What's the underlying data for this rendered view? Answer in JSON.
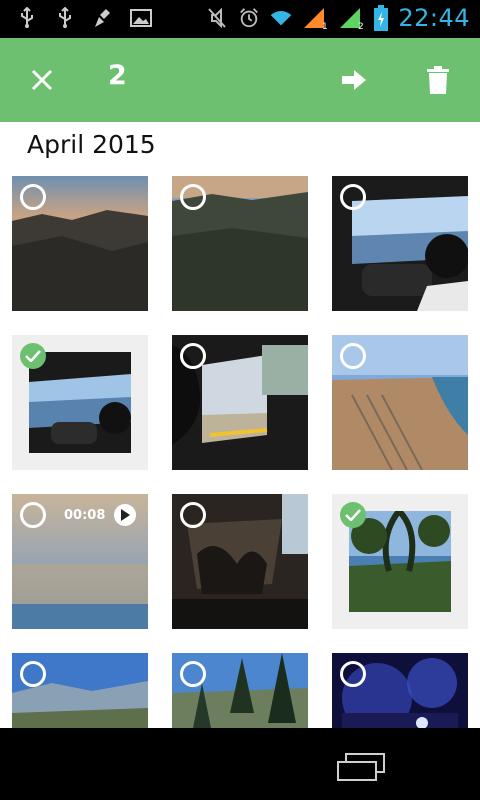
{
  "status_bar": {
    "time": "22:44",
    "icons": [
      "usb-icon",
      "usb-icon",
      "cleaner-icon",
      "image-icon",
      "mute-icon",
      "alarm-icon",
      "wifi-icon",
      "signal-icon",
      "signal-icon",
      "battery-icon"
    ],
    "network_labels": [
      "1",
      "2"
    ]
  },
  "action_bar": {
    "selected_count": "2",
    "close_icon": "close-icon",
    "share_icon": "forward-arrow-icon",
    "delete_icon": "trash-icon",
    "background_color": "#6cc070"
  },
  "gallery": {
    "section_title": "April 2015",
    "items": [
      {
        "kind": "photo",
        "selected": false,
        "scene": "mountain-sunset"
      },
      {
        "kind": "photo",
        "selected": false,
        "scene": "mountain-dusk"
      },
      {
        "kind": "photo",
        "selected": false,
        "scene": "helicopter-cockpit-sea"
      },
      {
        "kind": "photo",
        "selected": true,
        "scene": "helicopter-cockpit"
      },
      {
        "kind": "photo",
        "selected": false,
        "scene": "pilot-profile"
      },
      {
        "kind": "photo",
        "selected": false,
        "scene": "city-coast-aerial"
      },
      {
        "kind": "video",
        "selected": false,
        "duration": "00:08",
        "scene": "harbor-blur"
      },
      {
        "kind": "photo",
        "selected": false,
        "scene": "helicopter-interior"
      },
      {
        "kind": "photo",
        "selected": true,
        "scene": "tree-sea-view"
      },
      {
        "kind": "photo",
        "selected": false,
        "scene": "valley-blue-sky"
      },
      {
        "kind": "photo",
        "selected": false,
        "scene": "pine-trees"
      },
      {
        "kind": "photo",
        "selected": false,
        "scene": "concert-stage"
      }
    ]
  },
  "nav_bar": {
    "recents_icon": "recent-apps-icon"
  }
}
